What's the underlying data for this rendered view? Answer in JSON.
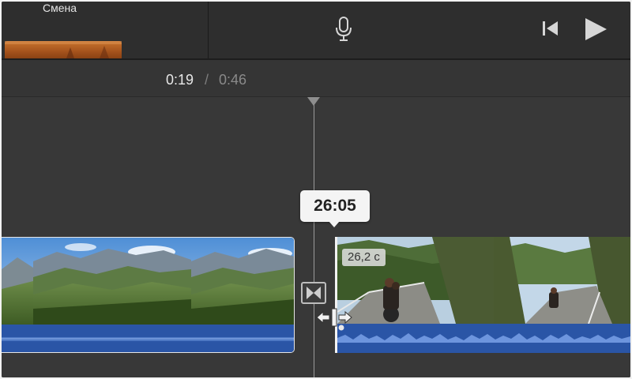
{
  "browser": {
    "transition_label": "Смена"
  },
  "toolbar": {
    "mic_icon": "microphone-icon",
    "skip_back_icon": "skip-to-start-icon",
    "play_icon": "play-icon"
  },
  "timecode": {
    "current": "0:19",
    "separator": "/",
    "total": "0:46"
  },
  "timeline": {
    "tooltip_duration": "26:05",
    "clip_right_duration": "26,2 с",
    "transition_icon": "cross-dissolve-icon",
    "trim_icon": "trim-resize-icon"
  },
  "colors": {
    "background": "#363636",
    "audio_track": "#2a55a6",
    "waveform": "#6d95de"
  }
}
